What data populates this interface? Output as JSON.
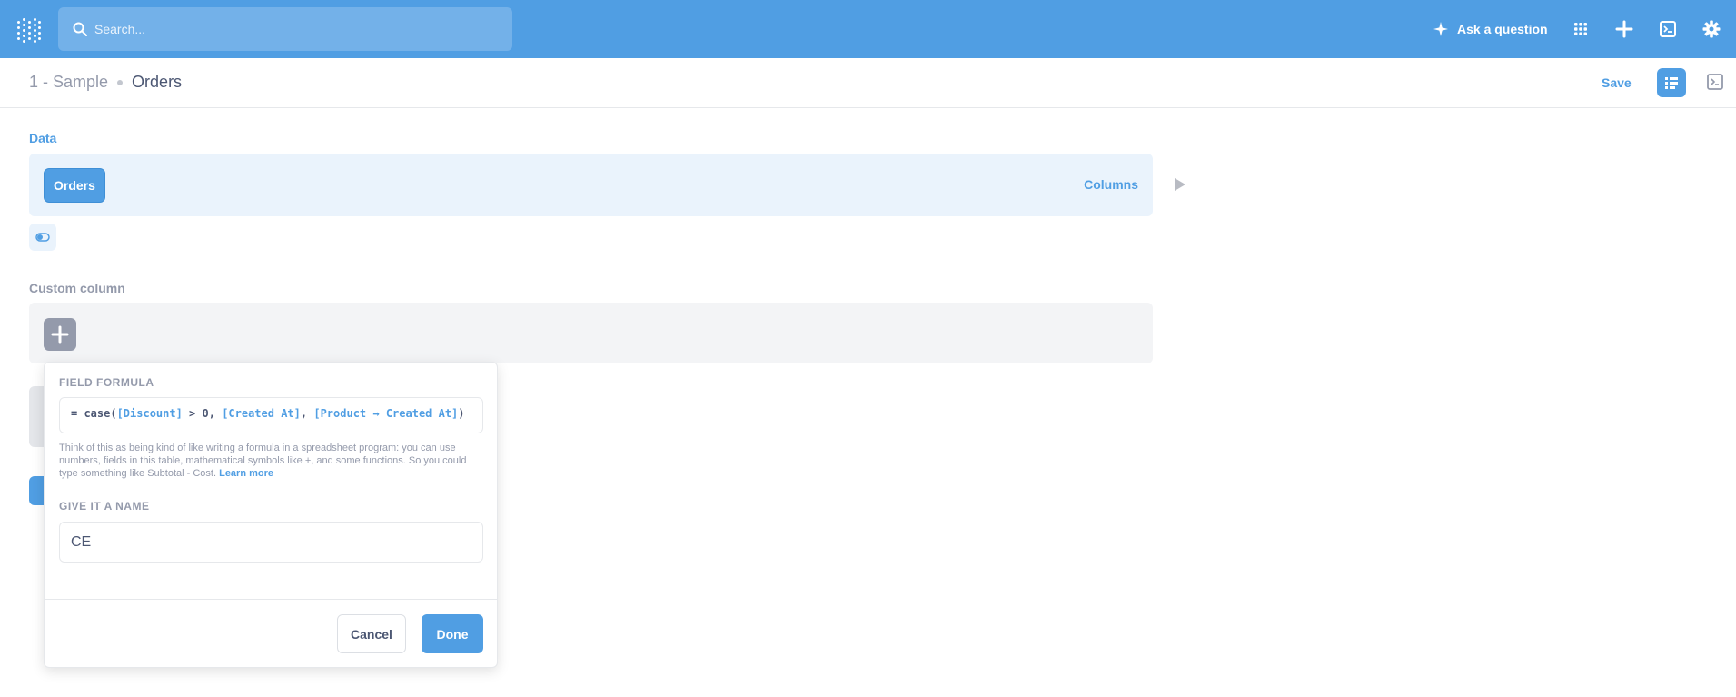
{
  "topbar": {
    "search_placeholder": "Search...",
    "ask_label": "Ask a question",
    "icons": [
      "metabase-logo-icon",
      "search-icon",
      "sparkle-icon",
      "grid-icon",
      "plus-icon",
      "terminal-icon",
      "gear-icon"
    ]
  },
  "header": {
    "breadcrumb_db": "1 - Sample",
    "breadcrumb_table": "Orders",
    "save_label": "Save"
  },
  "notebook": {
    "data_label": "Data",
    "table_name": "Orders",
    "columns_label": "Columns",
    "custom_column_label": "Custom column"
  },
  "popover": {
    "formula_label": "FIELD FORMULA",
    "formula": {
      "prefix": "= case(",
      "field1": "[Discount]",
      "middle": " > 0, ",
      "field2": "[Created At]",
      "sep": ", ",
      "field3": "[Product → Created At]",
      "suffix": ")"
    },
    "help_text": "Think of this as being kind of like writing a formula in a spreadsheet program: you can use numbers, fields in this table, mathematical symbols like +, and some functions. So you could type something like Subtotal - Cost.",
    "learn_more": "Learn more",
    "name_label": "GIVE IT A NAME",
    "name_value": "CE",
    "cancel_label": "Cancel",
    "done_label": "Done"
  },
  "colors": {
    "brand": "#509ee3",
    "text_dark": "#4c5773",
    "text_light": "#949aab"
  }
}
